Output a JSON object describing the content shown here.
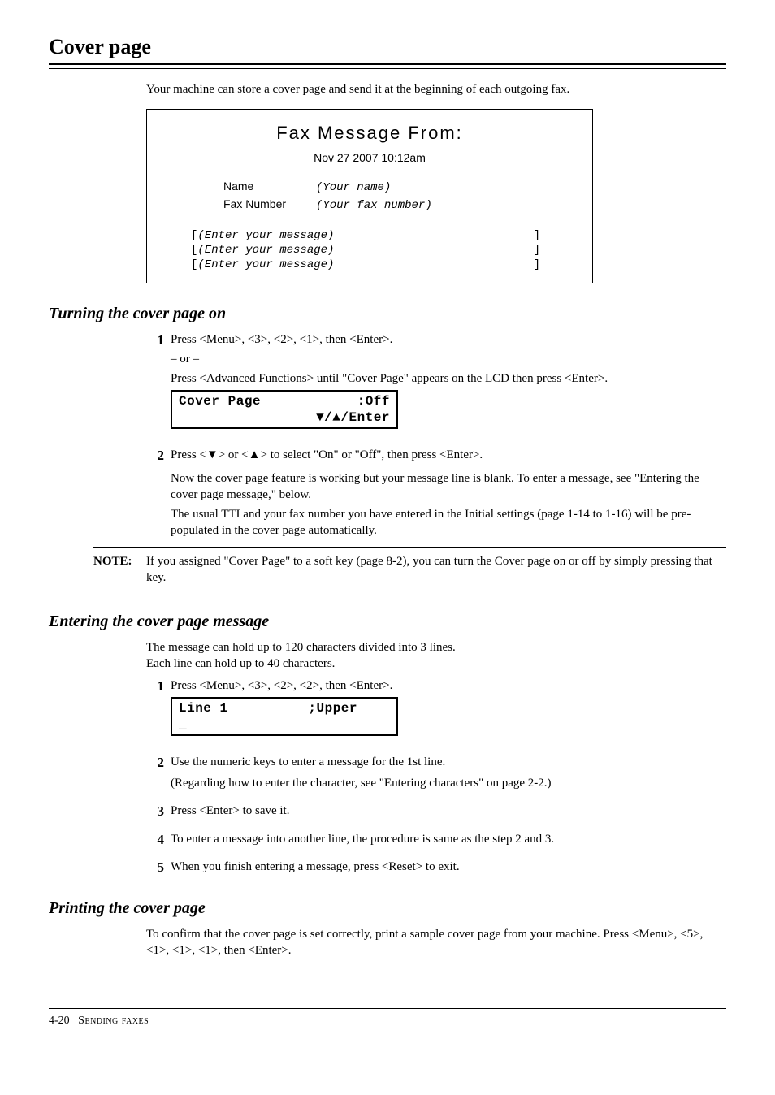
{
  "title": "Cover page",
  "intro": "Your machine can store a cover page and send it at the beginning of each outgoing fax.",
  "faxBox": {
    "heading": "Fax Message From:",
    "date": "Nov 27 2007 10:12am",
    "nameLabel": "Name",
    "nameValue": "(Your name)",
    "faxLabel": "Fax Number",
    "faxValue": "(Your fax number)",
    "msg": "(Enter your message)"
  },
  "sub1": {
    "title": "Turning the cover page on",
    "step1a": "Press <Menu>, <3>, <2>, <1>, then <Enter>.",
    "or": "– or –",
    "step1b": "Press <Advanced Functions> until \"Cover Page\" appears on the LCD then press <Enter>.",
    "lcd1_l": "Cover Page",
    "lcd1_r": ":Off",
    "lcd1_b": "▼/▲/Enter",
    "step2a": "Press <▼> or <▲> to select \"On\" or \"Off\", then press <Enter>.",
    "step2b": "Now the cover page feature is working but your message line is blank.  To enter a message, see \"Entering the cover page message,\" below.",
    "step2c": "The usual TTI and your fax number you have entered in the Initial settings (page 1-14 to 1-16) will be pre-populated in the cover page automatically.",
    "noteLabel": "NOTE:",
    "noteBody": "If you assigned \"Cover Page\" to a soft key (page 8-2), you can turn the Cover page on or off by simply pressing that key."
  },
  "sub2": {
    "title": "Entering the cover page message",
    "p1": "The message can hold up to 120 characters divided into 3 lines.",
    "p2": "Each line can hold up to 40 characters.",
    "step1": "Press <Menu>, <3>, <2>, <2>, then <Enter>.",
    "lcd_l": "Line 1",
    "lcd_r": ";Upper",
    "lcd_b": "_",
    "step2a": "Use the numeric keys to enter a message for the 1st line.",
    "step2b": "(Regarding how to enter the character, see \"Entering characters\" on page 2-2.)",
    "step3": "Press <Enter> to save it.",
    "step4": "To enter a message into another line, the procedure is same as the step 2 and 3.",
    "step5": "When you finish entering a message, press <Reset> to exit."
  },
  "sub3": {
    "title": "Printing the cover page",
    "p": "To confirm that the cover page is set correctly, print a sample cover page from your machine.  Press <Menu>, <5>, <1>, <1>, <1>, then <Enter>."
  },
  "footer": {
    "page": "4-20",
    "chapter": "Sending faxes"
  }
}
